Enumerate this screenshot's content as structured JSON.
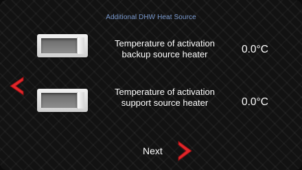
{
  "header": {
    "title": "Additional DHW  Heat Source"
  },
  "rows": [
    {
      "label_line1": "Temperature of activation",
      "label_line2": "backup source heater",
      "value": "0.0°C"
    },
    {
      "label_line1": "Temperature of activation",
      "label_line2": "support source heater",
      "value": "0.0°C"
    }
  ],
  "nav": {
    "next_label": "Next"
  },
  "colors": {
    "background": "#121212",
    "title_text": "#7b9bd0",
    "text": "#ffffff",
    "arrow": "#e0262a"
  },
  "icons": {
    "back": "chevron-left-icon",
    "next": "chevron-right-icon"
  }
}
